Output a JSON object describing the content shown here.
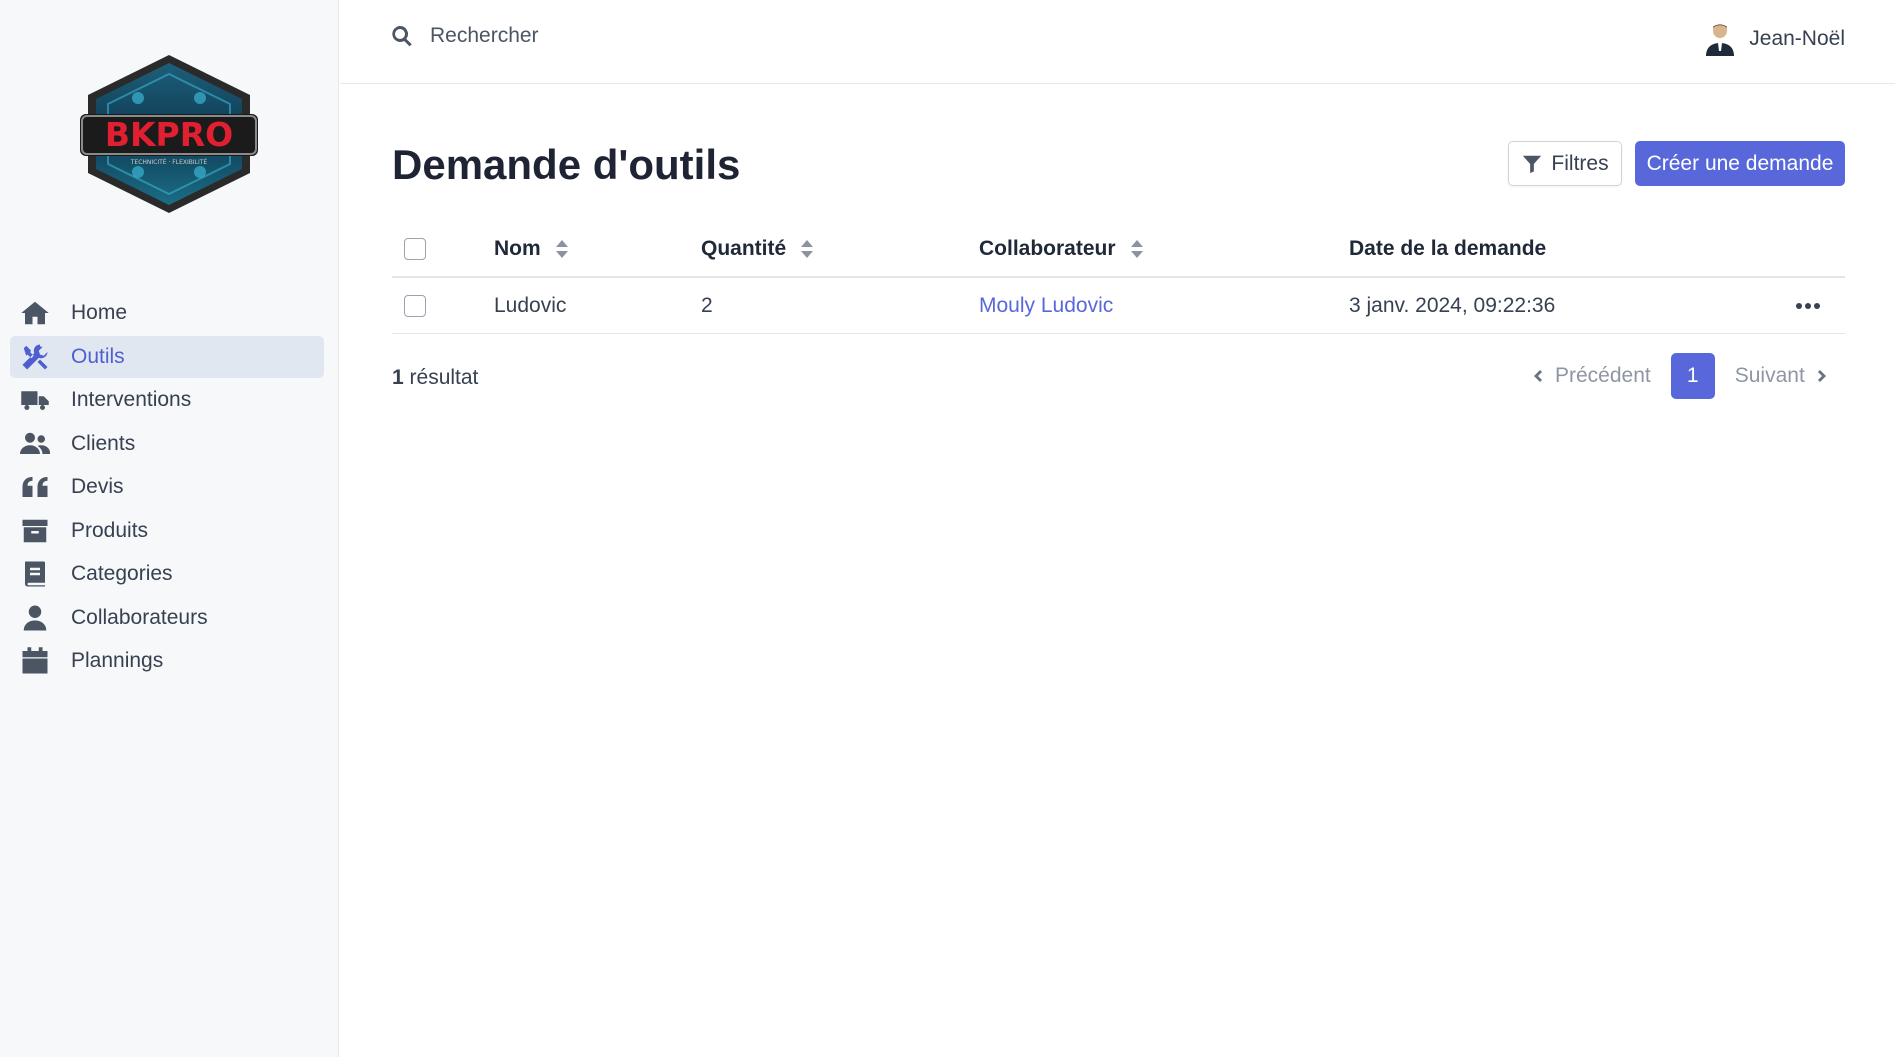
{
  "brand": {
    "logo_text": "BKPRO",
    "logo_tagline": "TECHNICITÉ · FLEXIBILITÉ"
  },
  "colors": {
    "accent": "#5868db",
    "sidebar_bg": "#f7f8fa",
    "active_bg": "#e1e7f1"
  },
  "sidebar": {
    "items": [
      {
        "label": "Home",
        "icon": "home-icon"
      },
      {
        "label": "Outils",
        "icon": "tools-icon",
        "active": true
      },
      {
        "label": "Interventions",
        "icon": "truck-icon"
      },
      {
        "label": "Clients",
        "icon": "users-icon"
      },
      {
        "label": "Devis",
        "icon": "quote-icon"
      },
      {
        "label": "Produits",
        "icon": "archive-icon"
      },
      {
        "label": "Categories",
        "icon": "book-icon"
      },
      {
        "label": "Collaborateurs",
        "icon": "user-icon"
      },
      {
        "label": "Plannings",
        "icon": "calendar-icon"
      }
    ]
  },
  "topbar": {
    "search_placeholder": "Rechercher",
    "user_name": "Jean-Noël"
  },
  "main": {
    "title": "Demande d'outils",
    "filters_label": "Filtres",
    "create_label": "Créer une demande"
  },
  "table": {
    "headers": {
      "name": "Nom",
      "quantity": "Quantité",
      "collaborator": "Collaborateur",
      "date": "Date de la demande"
    },
    "rows": [
      {
        "name": "Ludovic",
        "quantity": "2",
        "collaborator": "Mouly Ludovic",
        "date": "3 janv. 2024, 09:22:36"
      }
    ]
  },
  "footer": {
    "result_count": "1",
    "result_label": "résultat",
    "prev_label": "Précédent",
    "next_label": "Suivant",
    "current_page": "1"
  }
}
